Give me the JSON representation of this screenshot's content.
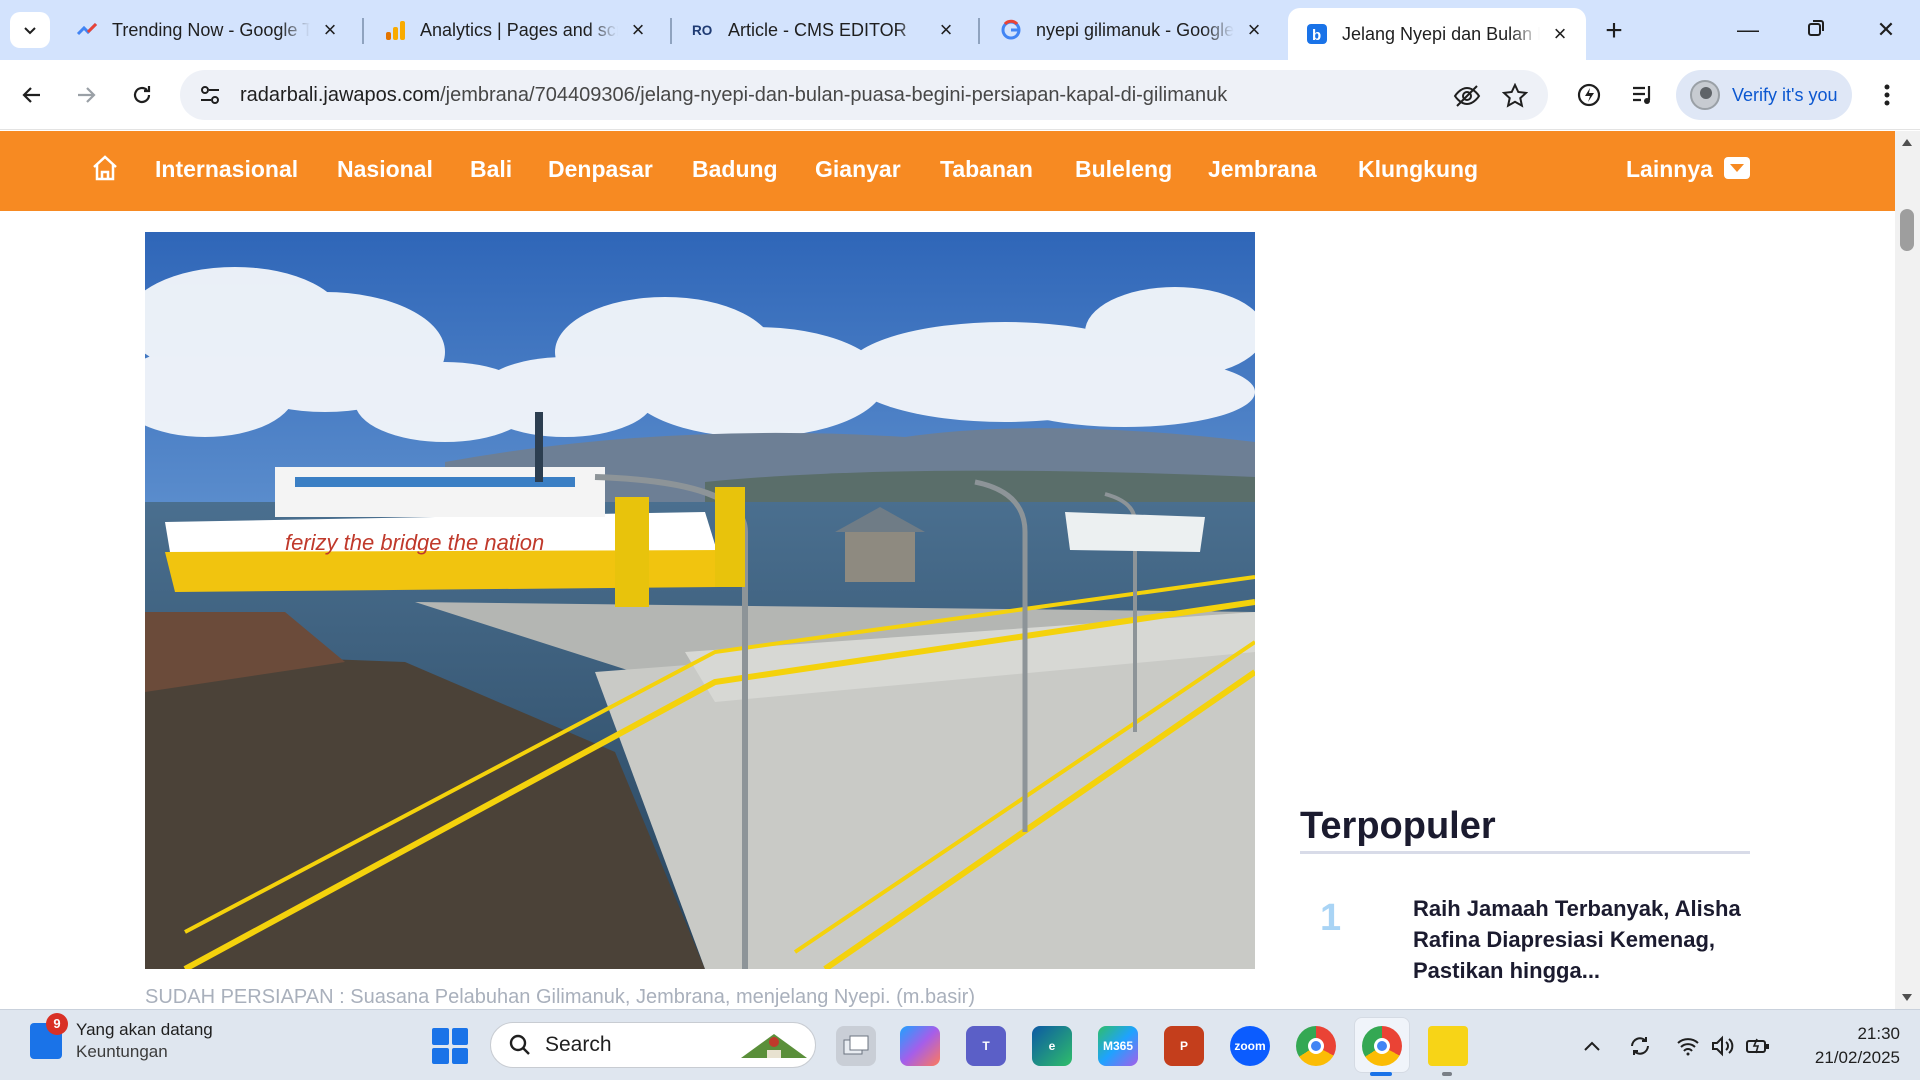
{
  "browser": {
    "tabs": [
      {
        "title": "Trending Now - Google Trends",
        "icon": "trends-icon",
        "active": false
      },
      {
        "title": "Analytics | Pages and screens",
        "icon": "analytics-icon",
        "active": false
      },
      {
        "title": "Article - CMS EDITOR",
        "icon": "cms-icon",
        "active": false
      },
      {
        "title": "nyepi gilimanuk - Google Search",
        "icon": "google-icon",
        "active": false
      },
      {
        "title": "Jelang Nyepi dan Bulan Puasa",
        "icon": "radarbali-icon",
        "active": true
      }
    ],
    "url_domain": "radarbali.jawapos.com",
    "url_path": "/jembrana/704409306/jelang-nyepi-dan-bulan-puasa-begini-persiapan-kapal-di-gilimanuk",
    "profile_label": "Verify it's you"
  },
  "site": {
    "nav": [
      "Internasional",
      "Nasional",
      "Bali",
      "Denpasar",
      "Badung",
      "Gianyar",
      "Tabanan",
      "Buleleng",
      "Jembrana",
      "Klungkung"
    ],
    "more_label": "Lainnya",
    "accent": "#f78a22"
  },
  "article": {
    "caption": "SUDAH PERSIAPAN : Suasana Pelabuhan Gilimanuk, Jembrana, menjelang Nyepi. (m.basir)"
  },
  "sidebar": {
    "popular_title": "Terpopuler",
    "items": [
      {
        "rank": "1",
        "title": "Raih Jamaah Terbanyak, Alisha Rafina Diapresiasi Kemenag, Pastikan hingga..."
      }
    ]
  },
  "taskbar": {
    "widget_title": "Yang akan datang",
    "widget_subtitle": "Keuntungan",
    "widget_badge": "9",
    "search_label": "Search",
    "time": "21:30",
    "date": "21/02/2025"
  }
}
